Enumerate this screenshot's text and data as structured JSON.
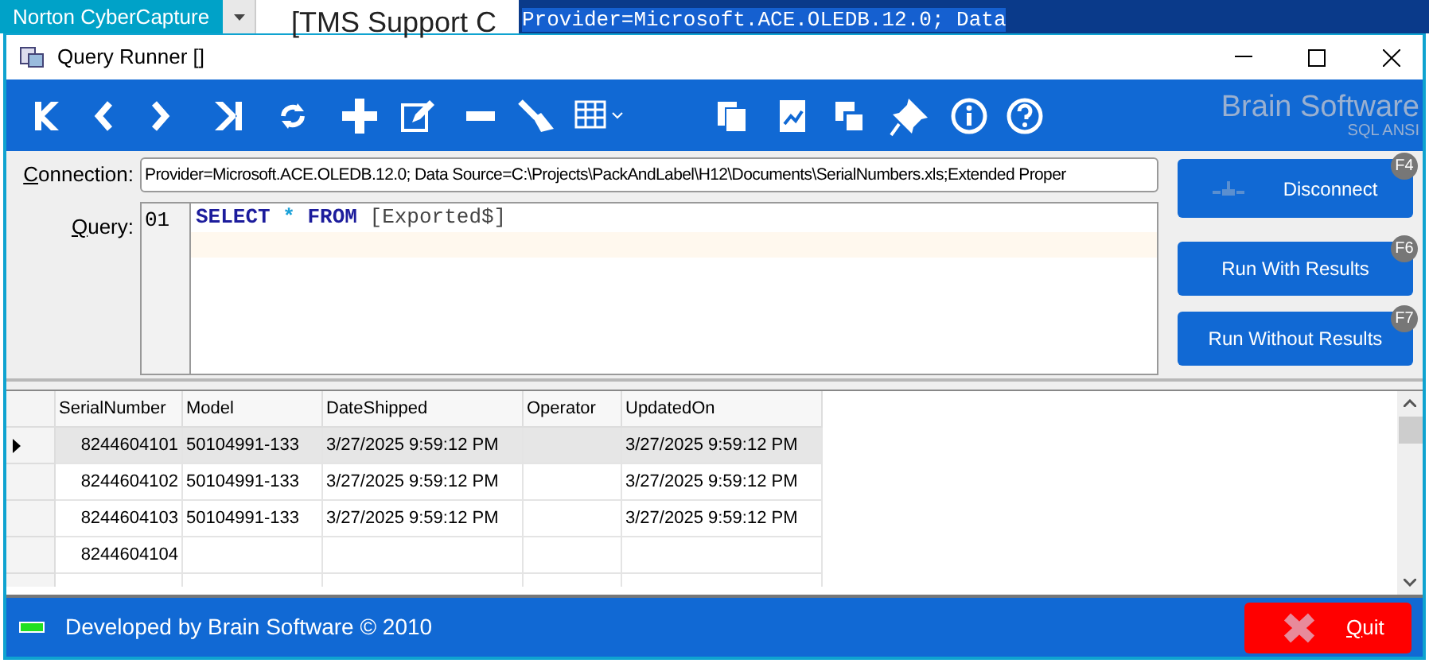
{
  "background": {
    "tab": "Norton CyberCapture",
    "document_title": "[TMS Support C",
    "selected_text": "Provider=Microsoft.ACE.OLEDB.12.0; Data"
  },
  "window": {
    "title": "Query Runner []"
  },
  "brand": {
    "name": "Brain Software",
    "subtitle": "SQL ANSI"
  },
  "connection": {
    "label": "Connection:",
    "value": "Provider=Microsoft.ACE.OLEDB.12.0; Data Source=C:\\Projects\\PackAndLabel\\H12\\Documents\\SerialNumbers.xls;Extended Proper"
  },
  "query": {
    "label": "Query:",
    "line_number": "01",
    "tokens": [
      {
        "kind": "keyword",
        "text": "SELECT"
      },
      {
        "kind": "operator",
        "text": "*"
      },
      {
        "kind": "keyword",
        "text": "FROM"
      },
      {
        "kind": "identifier",
        "text": "[Exported$]"
      }
    ]
  },
  "actions": [
    {
      "label": "Disconnect",
      "shortcut": "F4",
      "kind": "disconnect"
    },
    {
      "label": "Run With Results",
      "shortcut": "F6",
      "kind": "text"
    },
    {
      "label": "Run Without Results",
      "shortcut": "F7",
      "kind": "text"
    }
  ],
  "table": {
    "columns": [
      "SerialNumber",
      "Model",
      "DateShipped",
      "Operator",
      "UpdatedOn"
    ],
    "rows": [
      {
        "selected": true,
        "cells": [
          "8244604101",
          "50104991-133",
          "3/27/2025 9:59:12 PM",
          "",
          "3/27/2025 9:59:12 PM"
        ]
      },
      {
        "selected": false,
        "cells": [
          "8244604102",
          "50104991-133",
          "3/27/2025 9:59:12 PM",
          "",
          "3/27/2025 9:59:12 PM"
        ]
      },
      {
        "selected": false,
        "cells": [
          "8244604103",
          "50104991-133",
          "3/27/2025 9:59:12 PM",
          "",
          "3/27/2025 9:59:12 PM"
        ]
      },
      {
        "selected": false,
        "cells": [
          "8244604104",
          "",
          "",
          "",
          ""
        ]
      }
    ]
  },
  "status_bar": {
    "text": "Developed by Brain Software © 2010",
    "quit": "Quit"
  }
}
